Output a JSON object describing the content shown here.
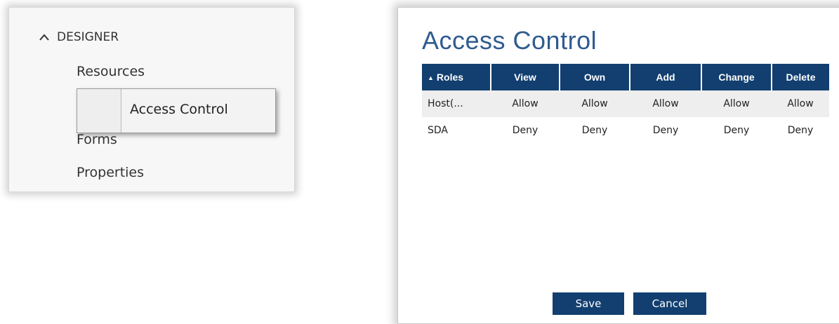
{
  "menu": {
    "header": "DESIGNER",
    "items": [
      "Resources",
      "Forms",
      "Properties"
    ],
    "context_popup": {
      "label": "Access Control"
    }
  },
  "dialog": {
    "title": "Access Control",
    "columns": [
      "Roles",
      "View",
      "Own",
      "Add",
      "Change",
      "Delete"
    ],
    "rows": [
      [
        "Host(...",
        "Allow",
        "Allow",
        "Allow",
        "Allow",
        "Allow"
      ],
      [
        "SDA",
        "Deny",
        "Deny",
        "Deny",
        "Deny",
        "Deny"
      ]
    ],
    "buttons": {
      "save": "Save",
      "cancel": "Cancel"
    }
  },
  "colors": {
    "header_bg": "#123f70",
    "title": "#2f5b8f",
    "row_alt": "#eeeeee"
  },
  "icons": {
    "collapse": "chevron-up-icon",
    "sort": "sort-ascending-icon"
  }
}
